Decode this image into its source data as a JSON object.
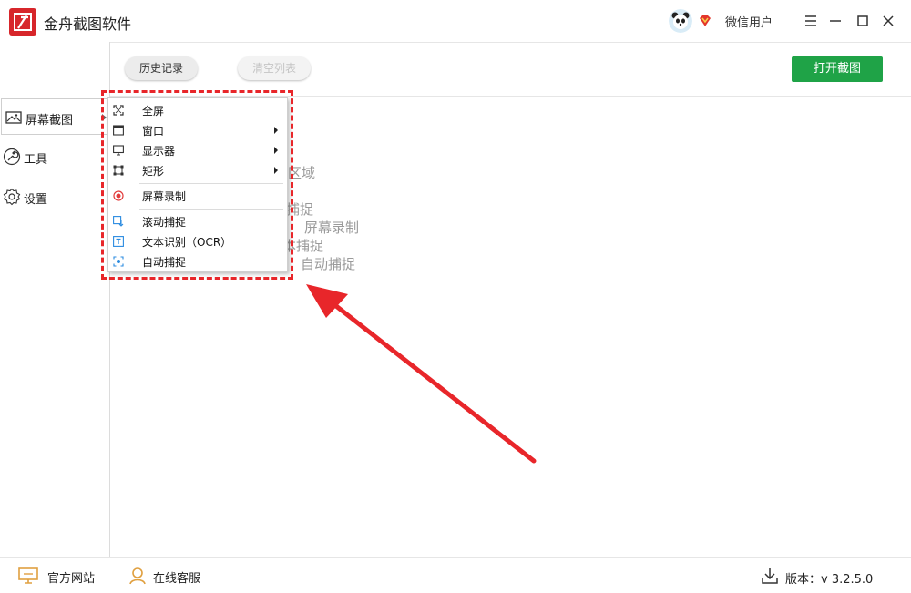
{
  "app": {
    "title": "金舟截图软件"
  },
  "user": {
    "name": "微信用户"
  },
  "sidebar": {
    "items": [
      {
        "label": "屏幕截图",
        "icon": "image-icon"
      },
      {
        "label": "工具",
        "icon": "wrench-icon"
      },
      {
        "label": "设置",
        "icon": "gear-icon"
      }
    ]
  },
  "toolbar": {
    "history_label": "历史记录",
    "clear_label": "清空列表",
    "open_label": "打开截图"
  },
  "hints": {
    "line1": "区域",
    "line2": "捕捉",
    "line3": "屏幕录制",
    "line4": "本捕捉",
    "line5": "自动捕捉"
  },
  "menu": {
    "items": [
      {
        "label": "全屏",
        "icon": "fullscreen-icon"
      },
      {
        "label": "窗口",
        "icon": "window-icon"
      },
      {
        "label": "显示器",
        "icon": "monitor-icon"
      },
      {
        "label": "矩形",
        "icon": "rectangle-icon"
      },
      {
        "label": "屏幕录制",
        "icon": "record-icon"
      },
      {
        "label": "滚动捕捉",
        "icon": "scroll-capture-icon"
      },
      {
        "label": "文本识别（OCR）",
        "icon": "ocr-icon"
      },
      {
        "label": "自动捕捉",
        "icon": "auto-capture-icon"
      }
    ]
  },
  "footer": {
    "website_label": "官方网站",
    "support_label": "在线客服",
    "version_label": "版本：v 3.2.5.0"
  },
  "colors": {
    "accent_green": "#1fa347",
    "highlight_red": "#e8262a",
    "logo_red": "#d7262b",
    "icon_orange": "#e0a040",
    "icon_blue": "#2b8be0"
  }
}
